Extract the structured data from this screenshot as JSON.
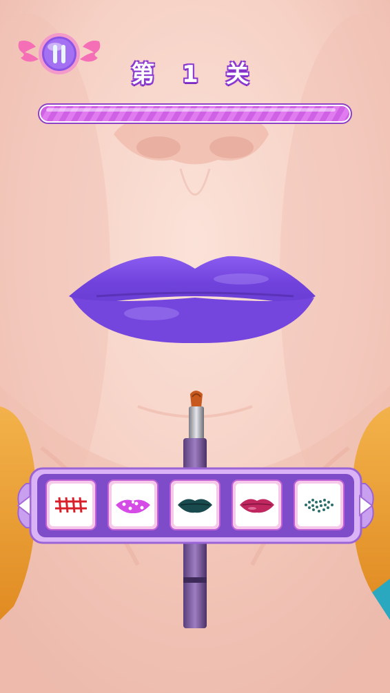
{
  "level": {
    "title": "第 1 关"
  },
  "progress": {
    "fill_fraction": 1.0,
    "color": "#d569e6"
  },
  "lip_color": "#7b4ce3",
  "palette": {
    "items": [
      {
        "name": "lip-stitch-pattern",
        "icon": "stitch-lips-icon",
        "color": "#d91f2a"
      },
      {
        "name": "lip-polka-dot",
        "icon": "polka-dot-lips-icon",
        "color": "#d44be6"
      },
      {
        "name": "lip-dark-teal",
        "icon": "dark-teal-lips-icon",
        "color": "#184a4e"
      },
      {
        "name": "lip-magenta",
        "icon": "magenta-lips-icon",
        "color": "#c0275f"
      },
      {
        "name": "lip-glitter-teal",
        "icon": "teal-glitter-lips-icon",
        "color": "#2c6e6e"
      }
    ],
    "accent": "#b47be4"
  }
}
